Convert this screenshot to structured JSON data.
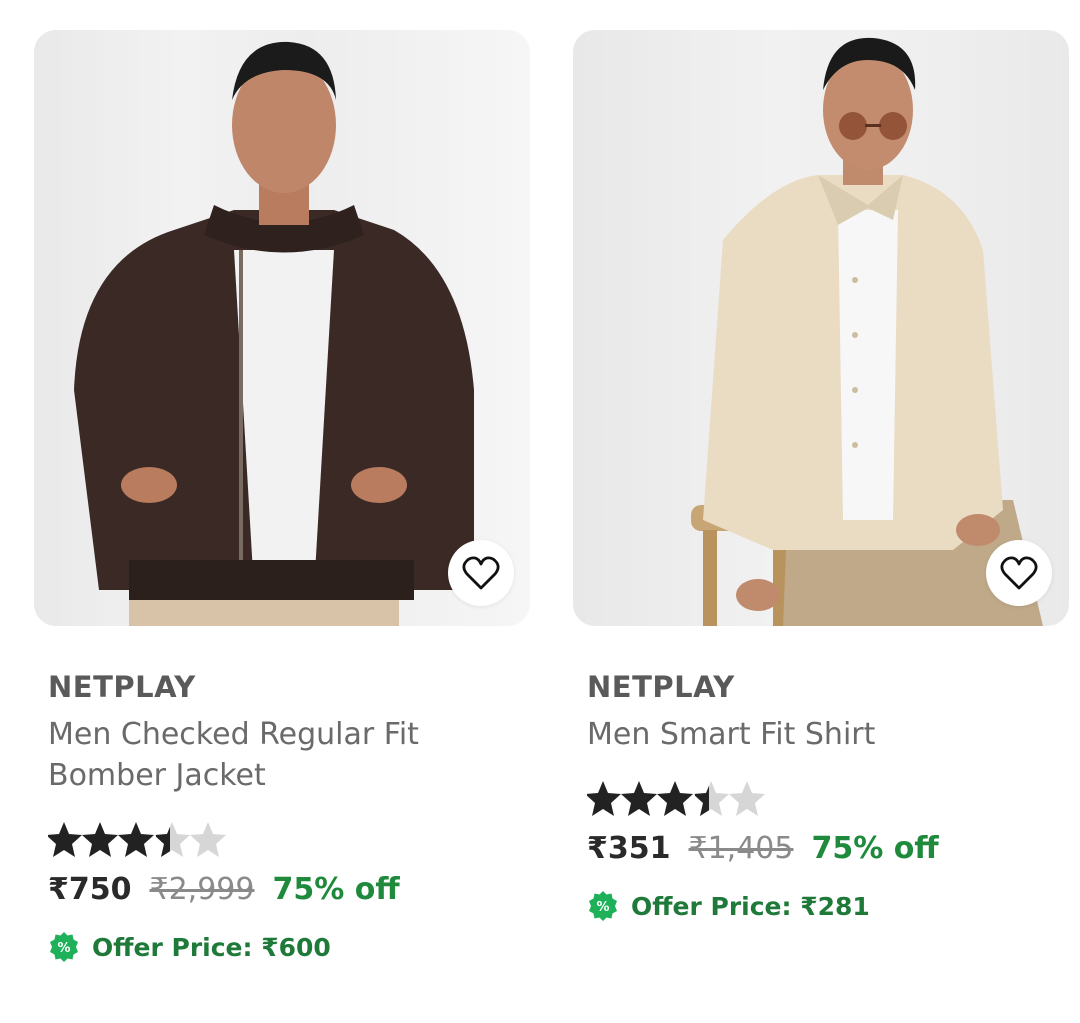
{
  "products": [
    {
      "brand": "NETPLAY",
      "title": "Men Checked Regular Fit Bomber Jacket",
      "rating": 3.5,
      "price": "₹750",
      "mrp": "₹2,999",
      "discount": "75% off",
      "offer_price": "Offer Price: ₹600",
      "image": "man-in-brown-bomber-jacket",
      "wishlist_icon": "heart-outline-icon"
    },
    {
      "brand": "NETPLAY",
      "title": "Men Smart Fit Shirt",
      "rating": 3.5,
      "price": "₹351",
      "mrp": "₹1,405",
      "discount": "75% off",
      "offer_price": "Offer Price: ₹281",
      "image": "man-in-beige-shirt",
      "wishlist_icon": "heart-outline-icon"
    }
  ],
  "colors": {
    "discount_green": "#1f8a3c",
    "offer_green": "#1f7a3a",
    "star_filled": "#222222",
    "star_empty": "#d6d6d6"
  }
}
